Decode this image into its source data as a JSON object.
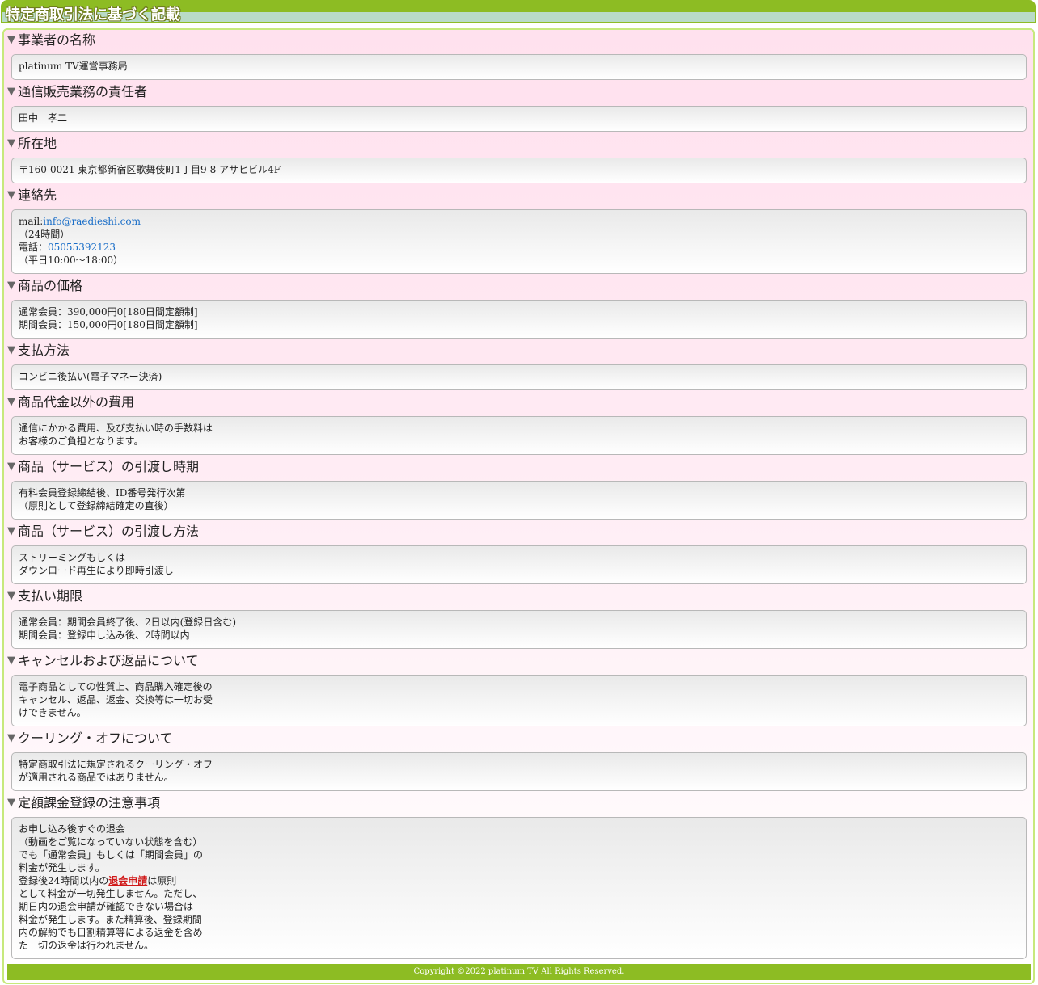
{
  "page_title": "特定商取引法に基づく記載",
  "sections": [
    {
      "heading": "事業者の名称",
      "lines": [
        "platinum TV運営事務局"
      ]
    },
    {
      "heading": "通信販売業務の責任者",
      "lines": [
        "田中　孝二"
      ]
    },
    {
      "heading": "所在地",
      "lines": [
        "〒160-0021 東京都新宿区歌舞伎町1丁目9-8 アサヒビル4F"
      ]
    },
    {
      "heading": "連絡先",
      "mail_prefix": "mail:",
      "mail": "info@raedieshi.com",
      "mail_hours": "（24時間）",
      "tel_prefix": "電話：",
      "tel": "05055392123",
      "tel_hours": "（平日10:00〜18:00）"
    },
    {
      "heading": "商品の価格",
      "lines": [
        "通常会員：390,000円0[180日間定額制]",
        "期間会員：150,000円0[180日間定額制]"
      ]
    },
    {
      "heading": "支払方法",
      "lines": [
        "コンビニ後払い(電子マネー決済)"
      ]
    },
    {
      "heading": "商品代金以外の費用",
      "lines": [
        "通信にかかる費用、及び支払い時の手数料は",
        "お客様のご負担となります。"
      ]
    },
    {
      "heading": "商品（サービス）の引渡し時期",
      "lines": [
        "有料会員登録締結後、ID番号発行次第",
        "（原則として登録締結確定の直後）"
      ]
    },
    {
      "heading": "商品（サービス）の引渡し方法",
      "lines": [
        "ストリーミングもしくは",
        "ダウンロード再生により即時引渡し"
      ]
    },
    {
      "heading": "支払い期限",
      "lines": [
        "通常会員：期間会員終了後、2日以内(登録日含む)",
        "期間会員：登録申し込み後、2時間以内"
      ]
    },
    {
      "heading": "キャンセルおよび返品について",
      "lines": [
        "電子商品としての性質上、商品購入確定後の",
        "キャンセル、返品、返金、交換等は一切お受",
        "けできません。"
      ]
    },
    {
      "heading": "クーリング・オフについて",
      "lines": [
        "特定商取引法に規定されるクーリング・オフ",
        "が適用される商品ではありません。"
      ]
    },
    {
      "heading": "定額課金登録の注意事項",
      "lines_before": [
        "お申し込み後すぐの退会",
        "（動画をご覧になっていない状態を含む）",
        "でも「通常会員」もしくは「期間会員」の",
        "料金が発生します。"
      ],
      "link_prefix": "登録後24時間以内の",
      "link_text": "退会申請",
      "link_suffix": "は原則",
      "lines_after": [
        "として料金が一切発生しません。ただし、",
        "期日内の退会申請が確認できない場合は",
        "料金が発生します。また精算後、登録期間",
        "内の解約でも日割精算等による返金を含め",
        "た一切の返金は行われません。"
      ]
    }
  ],
  "footer": "Copyright ©2022 platinum TV All Rights Reserved."
}
